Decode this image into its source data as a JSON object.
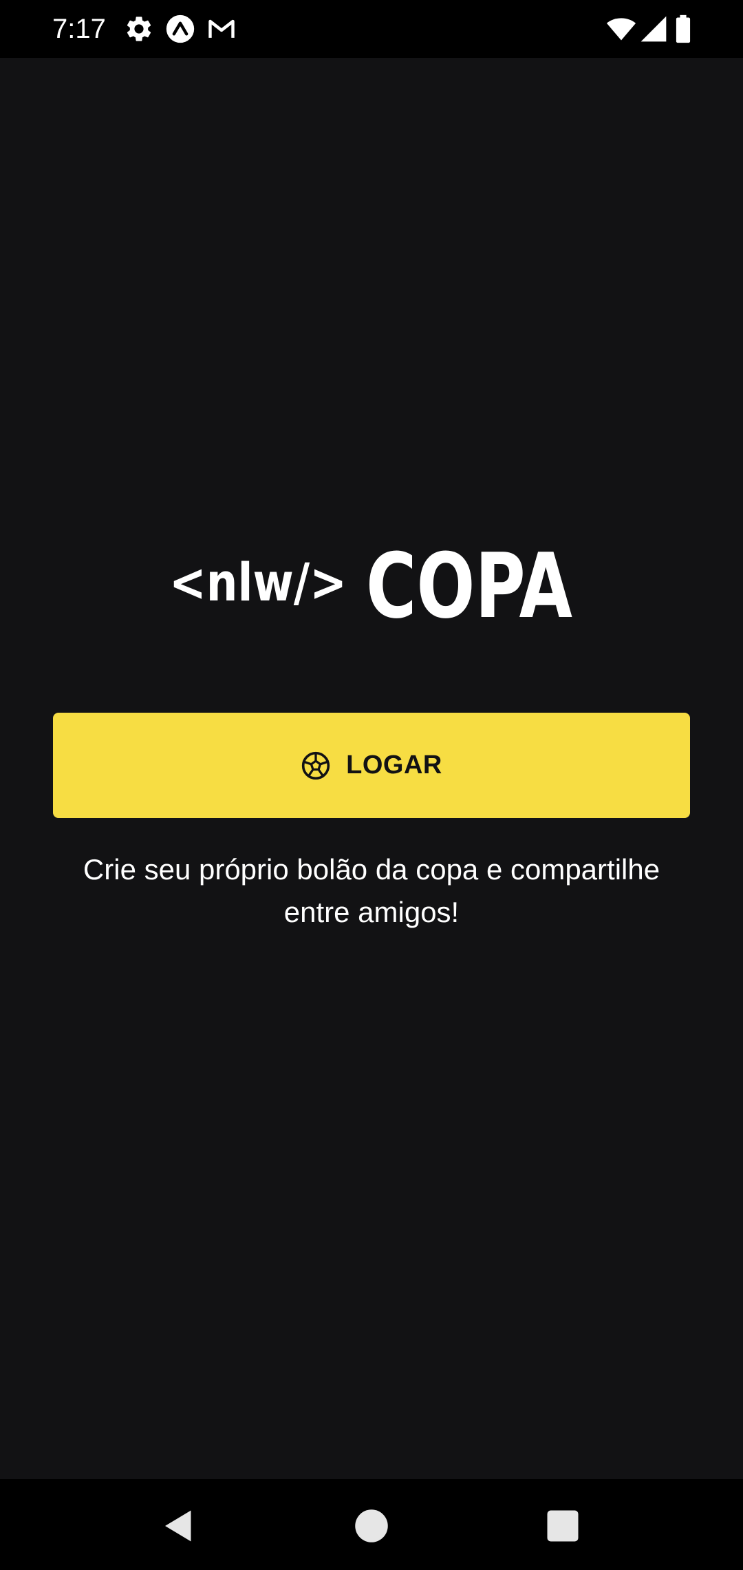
{
  "status_bar": {
    "time": "7:17",
    "icons_left": [
      "settings-icon",
      "expo-icon",
      "gmail-icon"
    ],
    "icons_right": [
      "wifi-icon",
      "signal-icon",
      "battery-icon"
    ]
  },
  "logo": {
    "text": "<nlw/> COPA"
  },
  "login_button": {
    "label": "LOGAR",
    "icon": "soccer-ball-icon"
  },
  "tagline": "Crie seu próprio bolão da copa e compartilhe entre amigos!",
  "nav_bar": {
    "buttons": [
      "back-icon",
      "home-icon",
      "recents-icon"
    ]
  },
  "colors": {
    "background": "#121214",
    "bars": "#000000",
    "accent": "#F7DD43",
    "text": "#FFFFFF",
    "button_text": "#121214"
  }
}
